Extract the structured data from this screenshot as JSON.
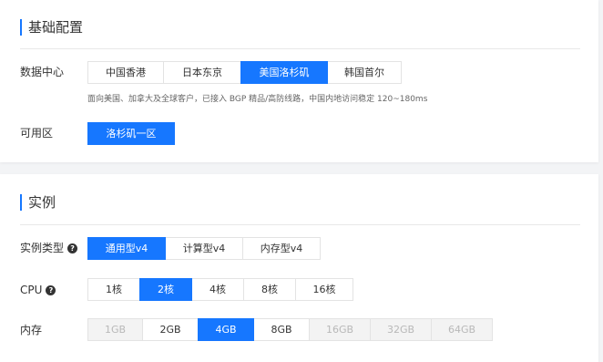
{
  "basic": {
    "title": "基础配置",
    "datacenter": {
      "label": "数据中心",
      "options": [
        {
          "label": "中国香港",
          "state": "normal"
        },
        {
          "label": "日本东京",
          "state": "normal"
        },
        {
          "label": "美国洛杉矶",
          "state": "active"
        },
        {
          "label": "韩国首尔",
          "state": "normal"
        }
      ],
      "description": "面向美国、加拿大及全球客户，已接入 BGP 精品/高防线路，中国内地访问稳定 120~180ms"
    },
    "zone": {
      "label": "可用区",
      "selected": "洛杉矶一区"
    }
  },
  "instance": {
    "title": "实例",
    "type": {
      "label": "实例类型",
      "options": [
        {
          "label": "通用型v4",
          "state": "active"
        },
        {
          "label": "计算型v4",
          "state": "normal"
        },
        {
          "label": "内存型v4",
          "state": "normal"
        }
      ]
    },
    "cpu": {
      "label": "CPU",
      "options": [
        {
          "label": "1核",
          "state": "normal"
        },
        {
          "label": "2核",
          "state": "active"
        },
        {
          "label": "4核",
          "state": "normal"
        },
        {
          "label": "8核",
          "state": "normal"
        },
        {
          "label": "16核",
          "state": "normal"
        }
      ]
    },
    "memory": {
      "label": "内存",
      "options": [
        {
          "label": "1GB",
          "state": "disabled"
        },
        {
          "label": "2GB",
          "state": "normal"
        },
        {
          "label": "4GB",
          "state": "active"
        },
        {
          "label": "8GB",
          "state": "normal"
        },
        {
          "label": "16GB",
          "state": "disabled"
        },
        {
          "label": "32GB",
          "state": "disabled"
        },
        {
          "label": "64GB",
          "state": "disabled"
        }
      ]
    }
  },
  "icons": {
    "help": "help-circle-icon"
  },
  "colors": {
    "accent": "#1677ff",
    "disabled_bg": "#f3f3f3"
  }
}
